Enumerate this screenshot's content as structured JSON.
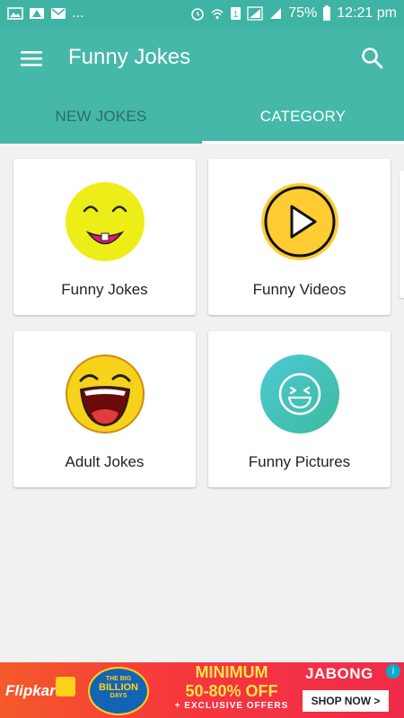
{
  "status_bar": {
    "left_icons": [
      "gallery-icon",
      "drive-icon",
      "mail-icon"
    ],
    "more": "...",
    "battery": "75%",
    "time": "12:21 pm"
  },
  "app_bar": {
    "title": "Funny Jokes",
    "color": "#45b8aa"
  },
  "tabs": [
    {
      "label": "NEW JOKES",
      "active": false
    },
    {
      "label": "CATEGORY",
      "active": true
    }
  ],
  "categories": [
    {
      "label": "Funny Jokes",
      "icon": "smiley-face-icon"
    },
    {
      "label": "Funny Videos",
      "icon": "play-button-icon"
    },
    {
      "label": "Adult Jokes",
      "icon": "laughing-face-icon"
    },
    {
      "label": "Funny Pictures",
      "icon": "laughing-emoji-icon"
    }
  ],
  "ad_banner": {
    "brand_left": "Flipkart",
    "badge_line1": "THE BIG",
    "badge_line2": "BILLION",
    "badge_line3": "DAYS",
    "offer_line1": "MINIMUM",
    "offer_line2": "50-80% OFF",
    "offer_line3": "+ EXCLUSIVE OFFERS",
    "brand_right": "JABONG",
    "cta": "SHOP NOW >"
  }
}
